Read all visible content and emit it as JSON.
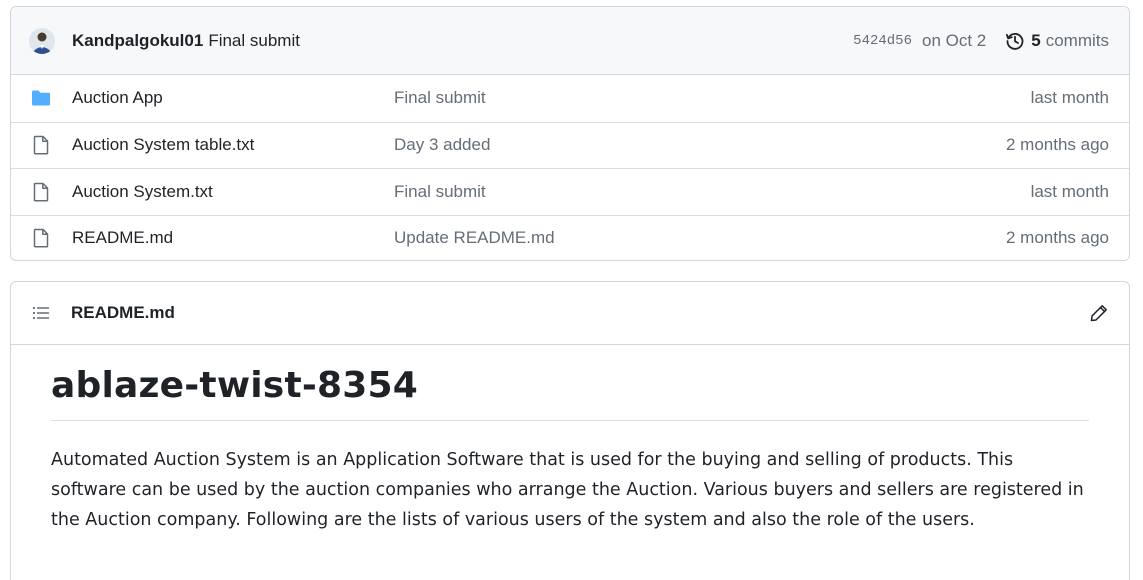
{
  "latest_commit": {
    "author": "Kandpalgokul01",
    "message": "Final submit",
    "sha": "5424d56",
    "date": "on Oct 2",
    "commits_count": "5",
    "commits_label": "commits",
    "avatar_icon": "user-avatar"
  },
  "files": [
    {
      "name": "Auction App",
      "type": "folder",
      "icon": "folder-icon",
      "commit": "Final submit",
      "age": "last month"
    },
    {
      "name": "Auction System table.txt",
      "type": "file",
      "icon": "file-icon",
      "commit": "Day 3 added",
      "age": "2 months ago"
    },
    {
      "name": "Auction System.txt",
      "type": "file",
      "icon": "file-icon",
      "commit": "Final submit",
      "age": "last month"
    },
    {
      "name": "README.md",
      "type": "file",
      "icon": "file-icon",
      "commit": "Update README.md",
      "age": "2 months ago"
    }
  ],
  "readme": {
    "filename": "README.md",
    "heading": "ablaze-twist-8354",
    "paragraph": "Automated Auction System is an Application Software that is used for the buying and selling of products. This software can be used by the auction companies who arrange the Auction. Various buyers and sellers are registered in the Auction company. Following are the lists of various users of the system and also the role of the users."
  },
  "colors": {
    "folder": "#54aeff",
    "muted_text": "#656d76",
    "border": "#d0d7de",
    "header_bg": "#f6f8fa"
  }
}
